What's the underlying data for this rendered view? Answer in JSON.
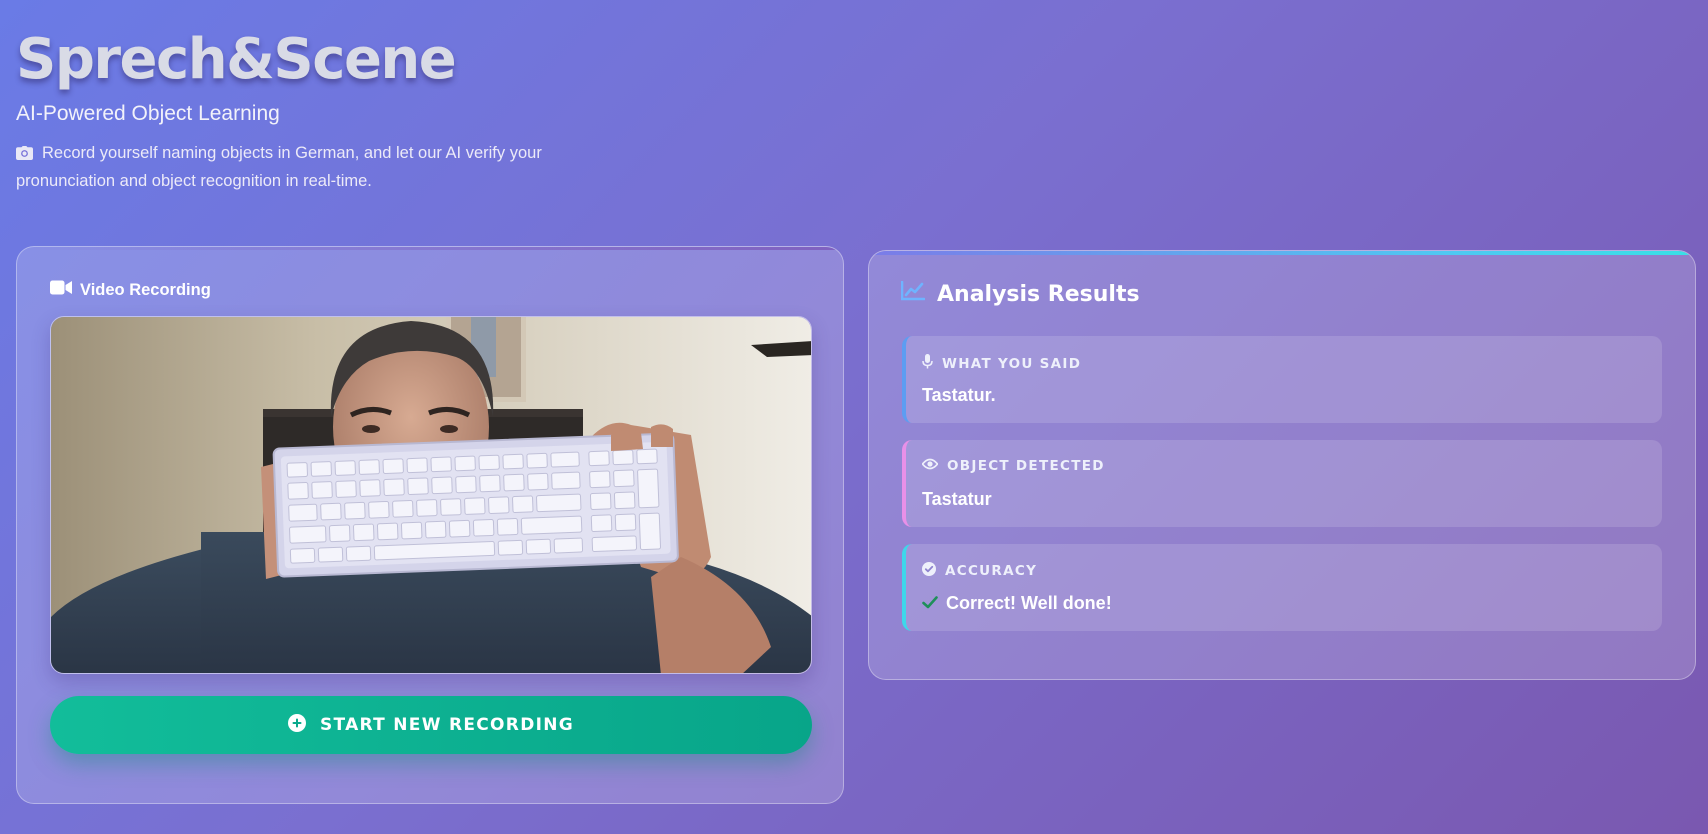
{
  "app": {
    "title": "Sprech&Scene",
    "subtitle": "AI-Powered Object Learning",
    "description": "Record yourself naming objects in German, and let our AI verify your pronunciation and object recognition in real-time."
  },
  "video_panel": {
    "header": "Video Recording",
    "button_label": "START NEW RECORDING"
  },
  "analysis_panel": {
    "header": "Analysis Results",
    "what_you_said": {
      "label": "WHAT YOU SAID",
      "value": "Tastatur."
    },
    "object_detected": {
      "label": "OBJECT DETECTED",
      "value": "Tastatur"
    },
    "accuracy": {
      "label": "ACCURACY",
      "value": "Correct! Well done!"
    }
  },
  "colors": {
    "accent_green": "#10b597",
    "said_border": "#5c9df2",
    "detected_border": "#e890e8",
    "accuracy_border": "#3ed7ea",
    "check_green": "#1f8f5a"
  },
  "icons": {
    "description": "camera-icon",
    "video_header": "video-camera-icon",
    "button": "plus-circle-icon",
    "analysis_header": "chart-line-icon",
    "said": "microphone-icon",
    "detected": "eye-icon",
    "accuracy": "check-circle-icon",
    "accuracy_value": "checkmark-icon"
  }
}
